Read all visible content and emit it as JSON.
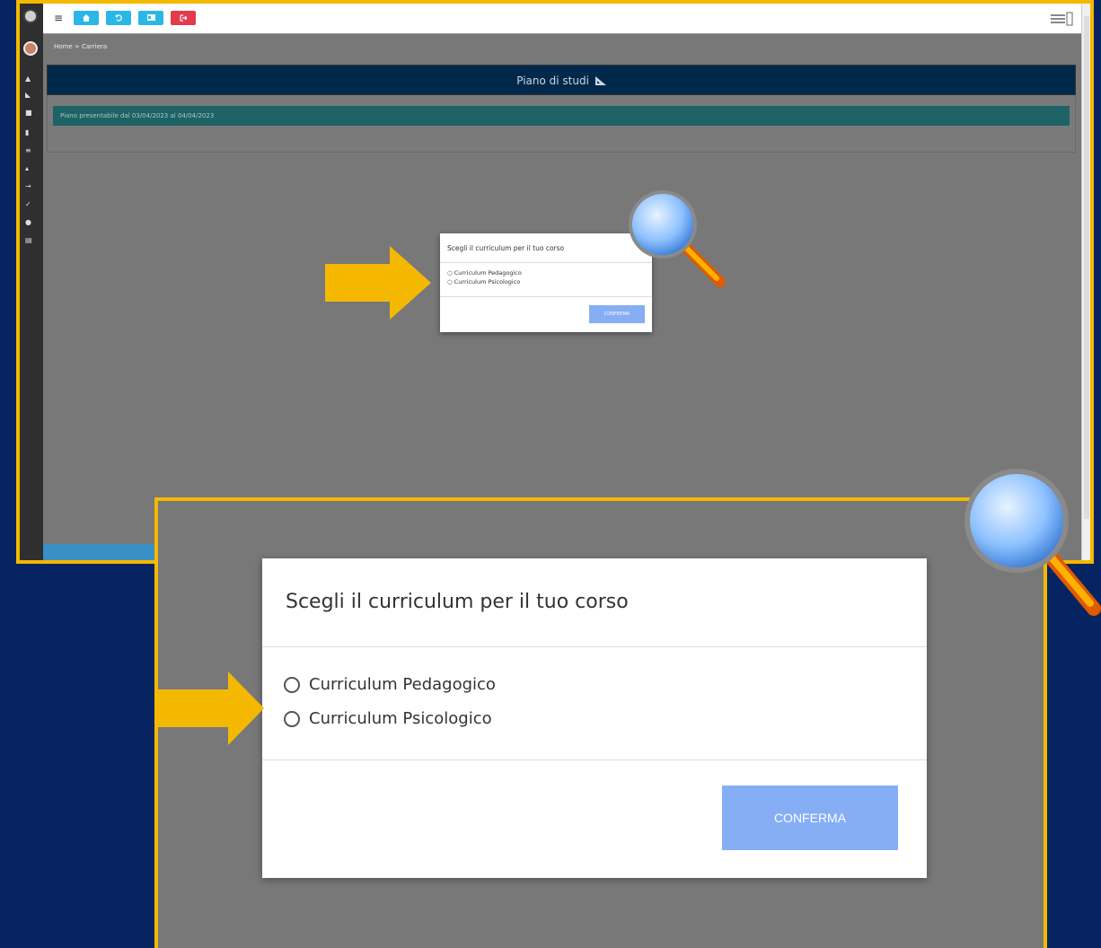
{
  "breadcrumb": "Home > Carriera",
  "piano_header": "Piano di studi",
  "piano_info": "Piano presentabile  dal  03/04/2023  al 04/04/2023",
  "modal": {
    "title": "Scegli il curriculum per il tuo corso",
    "options": [
      "Curriculum Pedagogico",
      "Curriculum Psicologico"
    ],
    "confirm_label": "CONFERMA"
  },
  "toolbar": {
    "icons": [
      "home-icon",
      "undo-icon",
      "id-card-icon",
      "logout-icon"
    ]
  },
  "colors": {
    "background": "#062461",
    "frame": "#f5b800",
    "overlay": "#787878",
    "header": "#00284b",
    "info_bar": "#1d6265",
    "confirm_button": "#86aef5",
    "toolbar_blue": "#2bb7e6",
    "toolbar_red": "#e23b4a"
  }
}
